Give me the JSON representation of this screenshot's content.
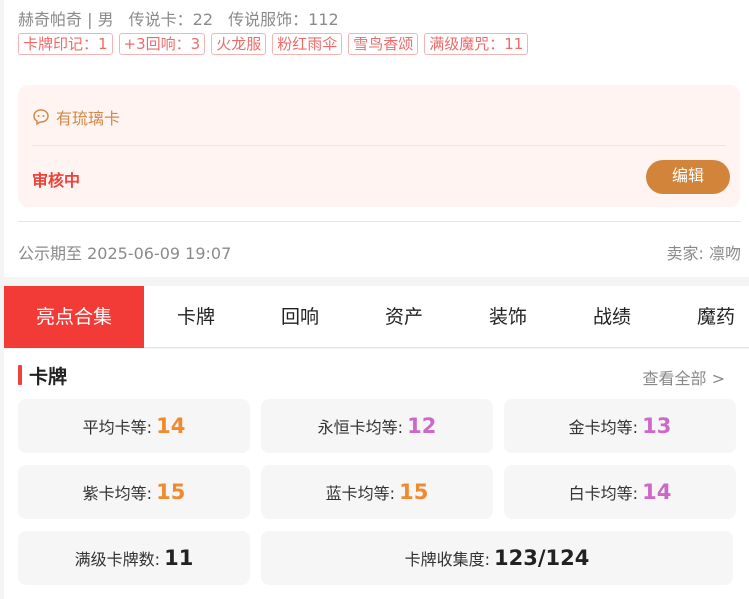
{
  "seller_info": {
    "name": "赫奇帕奇 | 男",
    "legend_cards": "传说卡：22",
    "legend_outfits": "传说服饰：112"
  },
  "tags": [
    "卡牌印记：1",
    "+3回响：3",
    "火龙服",
    "粉红雨伞",
    "雪鸟香颂",
    "满级魔咒：11"
  ],
  "review": {
    "headline": "有琉璃卡",
    "status": "审核中",
    "edit_label": "编辑"
  },
  "footer": {
    "public_until": "公示期至 2025-06-09 19:07",
    "seller": "卖家: 凛吻"
  },
  "tabs": [
    "亮点合集",
    "卡牌",
    "回响",
    "资产",
    "装饰",
    "战绩",
    "魔药"
  ],
  "cards_section": {
    "title": "卡牌",
    "view_all": "查看全部 >",
    "stats": [
      {
        "label": "平均卡等:",
        "value": "14",
        "color": "#ef8a2e"
      },
      {
        "label": "永恒卡均等:",
        "value": "12",
        "color": "#cc68c8"
      },
      {
        "label": "金卡均等:",
        "value": "13",
        "color": "#cc68c8"
      },
      {
        "label": "紫卡均等:",
        "value": "15",
        "color": "#ef8a2e"
      },
      {
        "label": "蓝卡均等:",
        "value": "15",
        "color": "#ef8a2e"
      },
      {
        "label": "白卡均等:",
        "value": "14",
        "color": "#cc68c8"
      },
      {
        "label": "满级卡牌数:",
        "value": "11",
        "color": "#222222"
      },
      {
        "label": "卡牌收集度:",
        "value": "123/124",
        "color": "#222222"
      }
    ]
  },
  "colors": {
    "accent_red": "#f23b36",
    "edit_button": "#d2843a",
    "review_bg": "#fff4f1"
  }
}
